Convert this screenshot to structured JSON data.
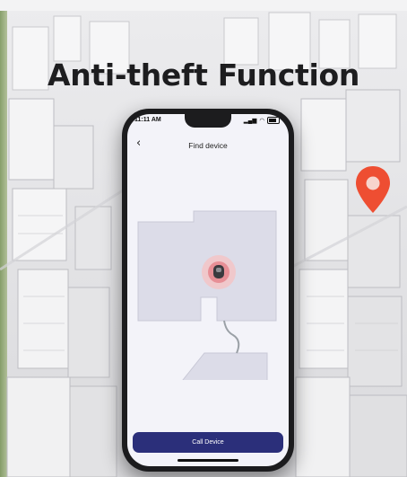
{
  "headline": "Anti-theft Function",
  "colors": {
    "accent": "#2b2f7a",
    "pin": "#ee4e32",
    "locator": "#d9606b"
  },
  "phone": {
    "status_time": "11:11 AM",
    "signal_icon": "signal-icon",
    "wifi_icon": "wifi-icon",
    "battery_icon": "battery-icon",
    "back_icon": "chevron-left-icon",
    "nav_title": "Find device",
    "call_button": "Call Device"
  }
}
